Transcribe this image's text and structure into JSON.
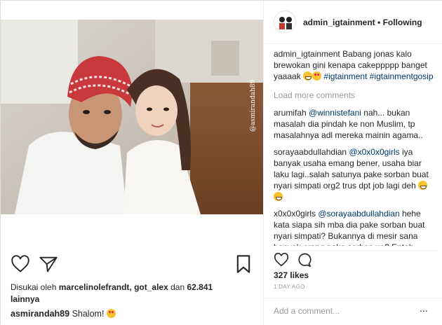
{
  "post": {
    "photo_watermark": "@asmirandah89",
    "like_prefix": "Disukai oleh",
    "like_users": "marcelinolefrandt, got_alex",
    "like_conj": "dan",
    "like_count": "62.841",
    "like_suffix": "lainnya",
    "caption_user": "asmirandah89",
    "caption_text": "Shalom!"
  },
  "panel": {
    "username": "admin_igtainment",
    "separator": "•",
    "follow_label": "Following",
    "owner_comment_user": "admin_igtainment",
    "owner_comment_text": "Babang jonas kalo brewokan gini kenapa cakeppppp banget yaaaak",
    "owner_tags": [
      "#igtainment",
      "#igtainmentgosip"
    ],
    "load_more": "Load more comments",
    "comments": [
      {
        "user": "arumifah",
        "mention": "@winnistefani",
        "text": "nah... bukan masalah dia pindah ke non Muslim, tp masalahnya adl mereka mainin agama.."
      },
      {
        "user": "sorayaabdullahdian",
        "mention": "@x0x0x0girls",
        "text": "iya banyak usaha emang bener, usaha biar laku lagi..salah satunya pake sorban buat nyari simpati org2 trus dpt job lagi deh"
      },
      {
        "user": "x0x0x0girls",
        "mention": "@sorayaabdullahdian",
        "text": "hehe kata siapa sih mba dia pake sorban buat nyari simpati? Bukannya di mesir sana banyak orang pake sorban ya? Entah agamanya mau apapun, sorban kan banyalah penutup kepala :) cmiiw yaa"
      }
    ],
    "likes_text": "327 likes",
    "date_text": "1 DAY AGO",
    "add_comment_placeholder": "Add a comment...",
    "more_label": "..."
  },
  "colors": {
    "link": "#003569",
    "muted": "#999999",
    "border": "#efefef"
  }
}
